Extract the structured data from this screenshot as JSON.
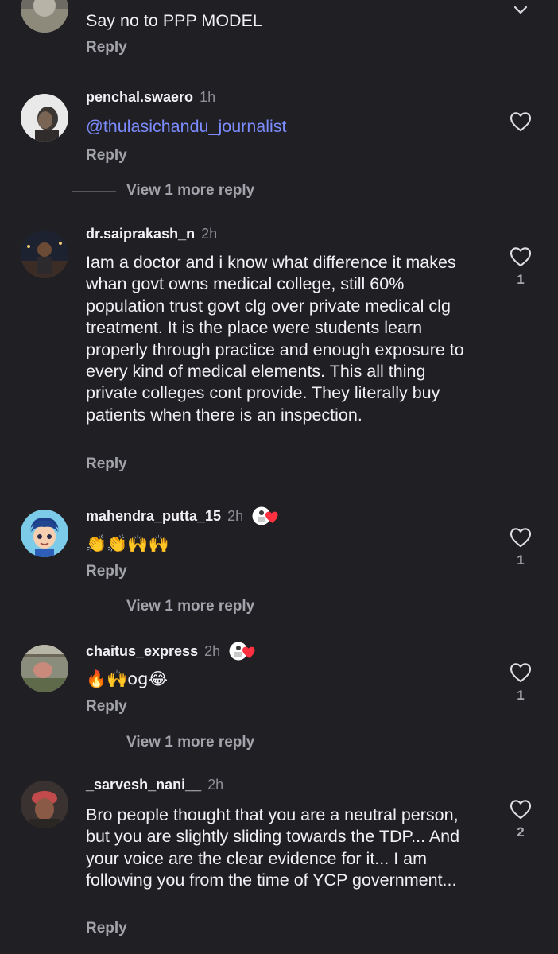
{
  "comments": [
    {
      "username": "",
      "time": "",
      "text": "Say no to PPP MODEL",
      "reply_label": "Reply",
      "like_count": ""
    },
    {
      "username": "penchal.swaero",
      "time": "1h",
      "mention": "@thulasichandu_journalist",
      "reply_label": "Reply",
      "like_count": "",
      "view_replies": "View 1 more reply"
    },
    {
      "username": "dr.saiprakash_n",
      "time": "2h",
      "text": "Iam a doctor and i know what difference it makes whan govt owns medical college, still 60% population trust govt clg over private medical clg treatment. It is the place were students learn properly through practice and enough exposure to every kind of medical elements. This all thing private colleges cont provide. They literally buy patients when there is an inspection.",
      "reply_label": "Reply",
      "like_count": "1"
    },
    {
      "username": "mahendra_putta_15",
      "time": "2h",
      "text": "👏👏🙌🙌",
      "reply_label": "Reply",
      "like_count": "1",
      "creator_liked": true,
      "view_replies": "View 1 more reply"
    },
    {
      "username": "chaitus_express",
      "time": "2h",
      "text": "🔥🙌og😂",
      "reply_label": "Reply",
      "like_count": "1",
      "creator_liked": true,
      "view_replies": "View 1 more reply"
    },
    {
      "username": "_sarvesh_nani__",
      "time": "2h",
      "text": "Bro people thought that you are a neutral person, but you are slightly sliding towards the TDP... And your voice are the clear evidence for it... I am following you from the time of YCP government...",
      "reply_label": "Reply",
      "like_count": "2"
    }
  ],
  "icons": {
    "like": "heart-outline-icon",
    "creator_like": "creator-heart-icon"
  },
  "colors": {
    "background": "#202024",
    "mention": "#7c8cff",
    "secondary_text": "#a3a3ab",
    "heart_red": "#ff3040"
  }
}
